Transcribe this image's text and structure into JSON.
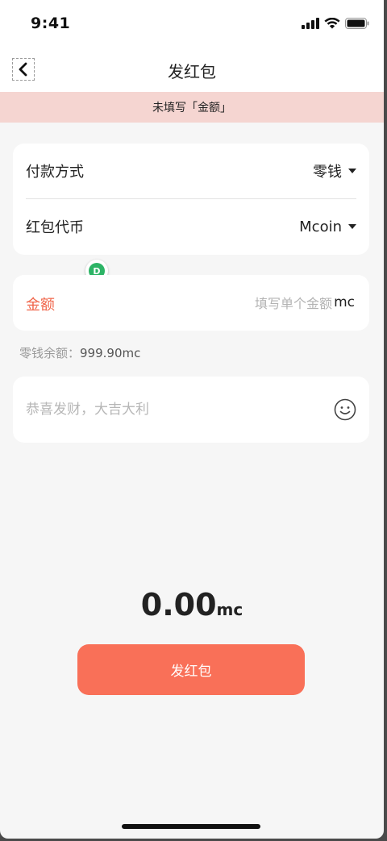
{
  "status_bar": {
    "time": "9:41"
  },
  "nav": {
    "title": "发红包"
  },
  "warning": {
    "text": "未填写「金额」"
  },
  "payment": {
    "method_label": "付款方式",
    "method_value": "零钱",
    "token_label": "红包代币",
    "token_value": "Mcoin"
  },
  "badge": {
    "letter": "D"
  },
  "amount": {
    "label": "金额",
    "placeholder": "填写单个金额",
    "unit": "mc"
  },
  "balance": {
    "label": "零钱余额：",
    "value": "999.90mc"
  },
  "message": {
    "placeholder": "恭喜发财，大吉大利"
  },
  "total": {
    "value": "0.00",
    "unit": "mc"
  },
  "submit": {
    "label": "发红包"
  },
  "colors": {
    "accent": "#f97058",
    "amount_label": "#f0654a",
    "warning_bg": "#f5d5d1",
    "badge_green": "#2db466"
  }
}
